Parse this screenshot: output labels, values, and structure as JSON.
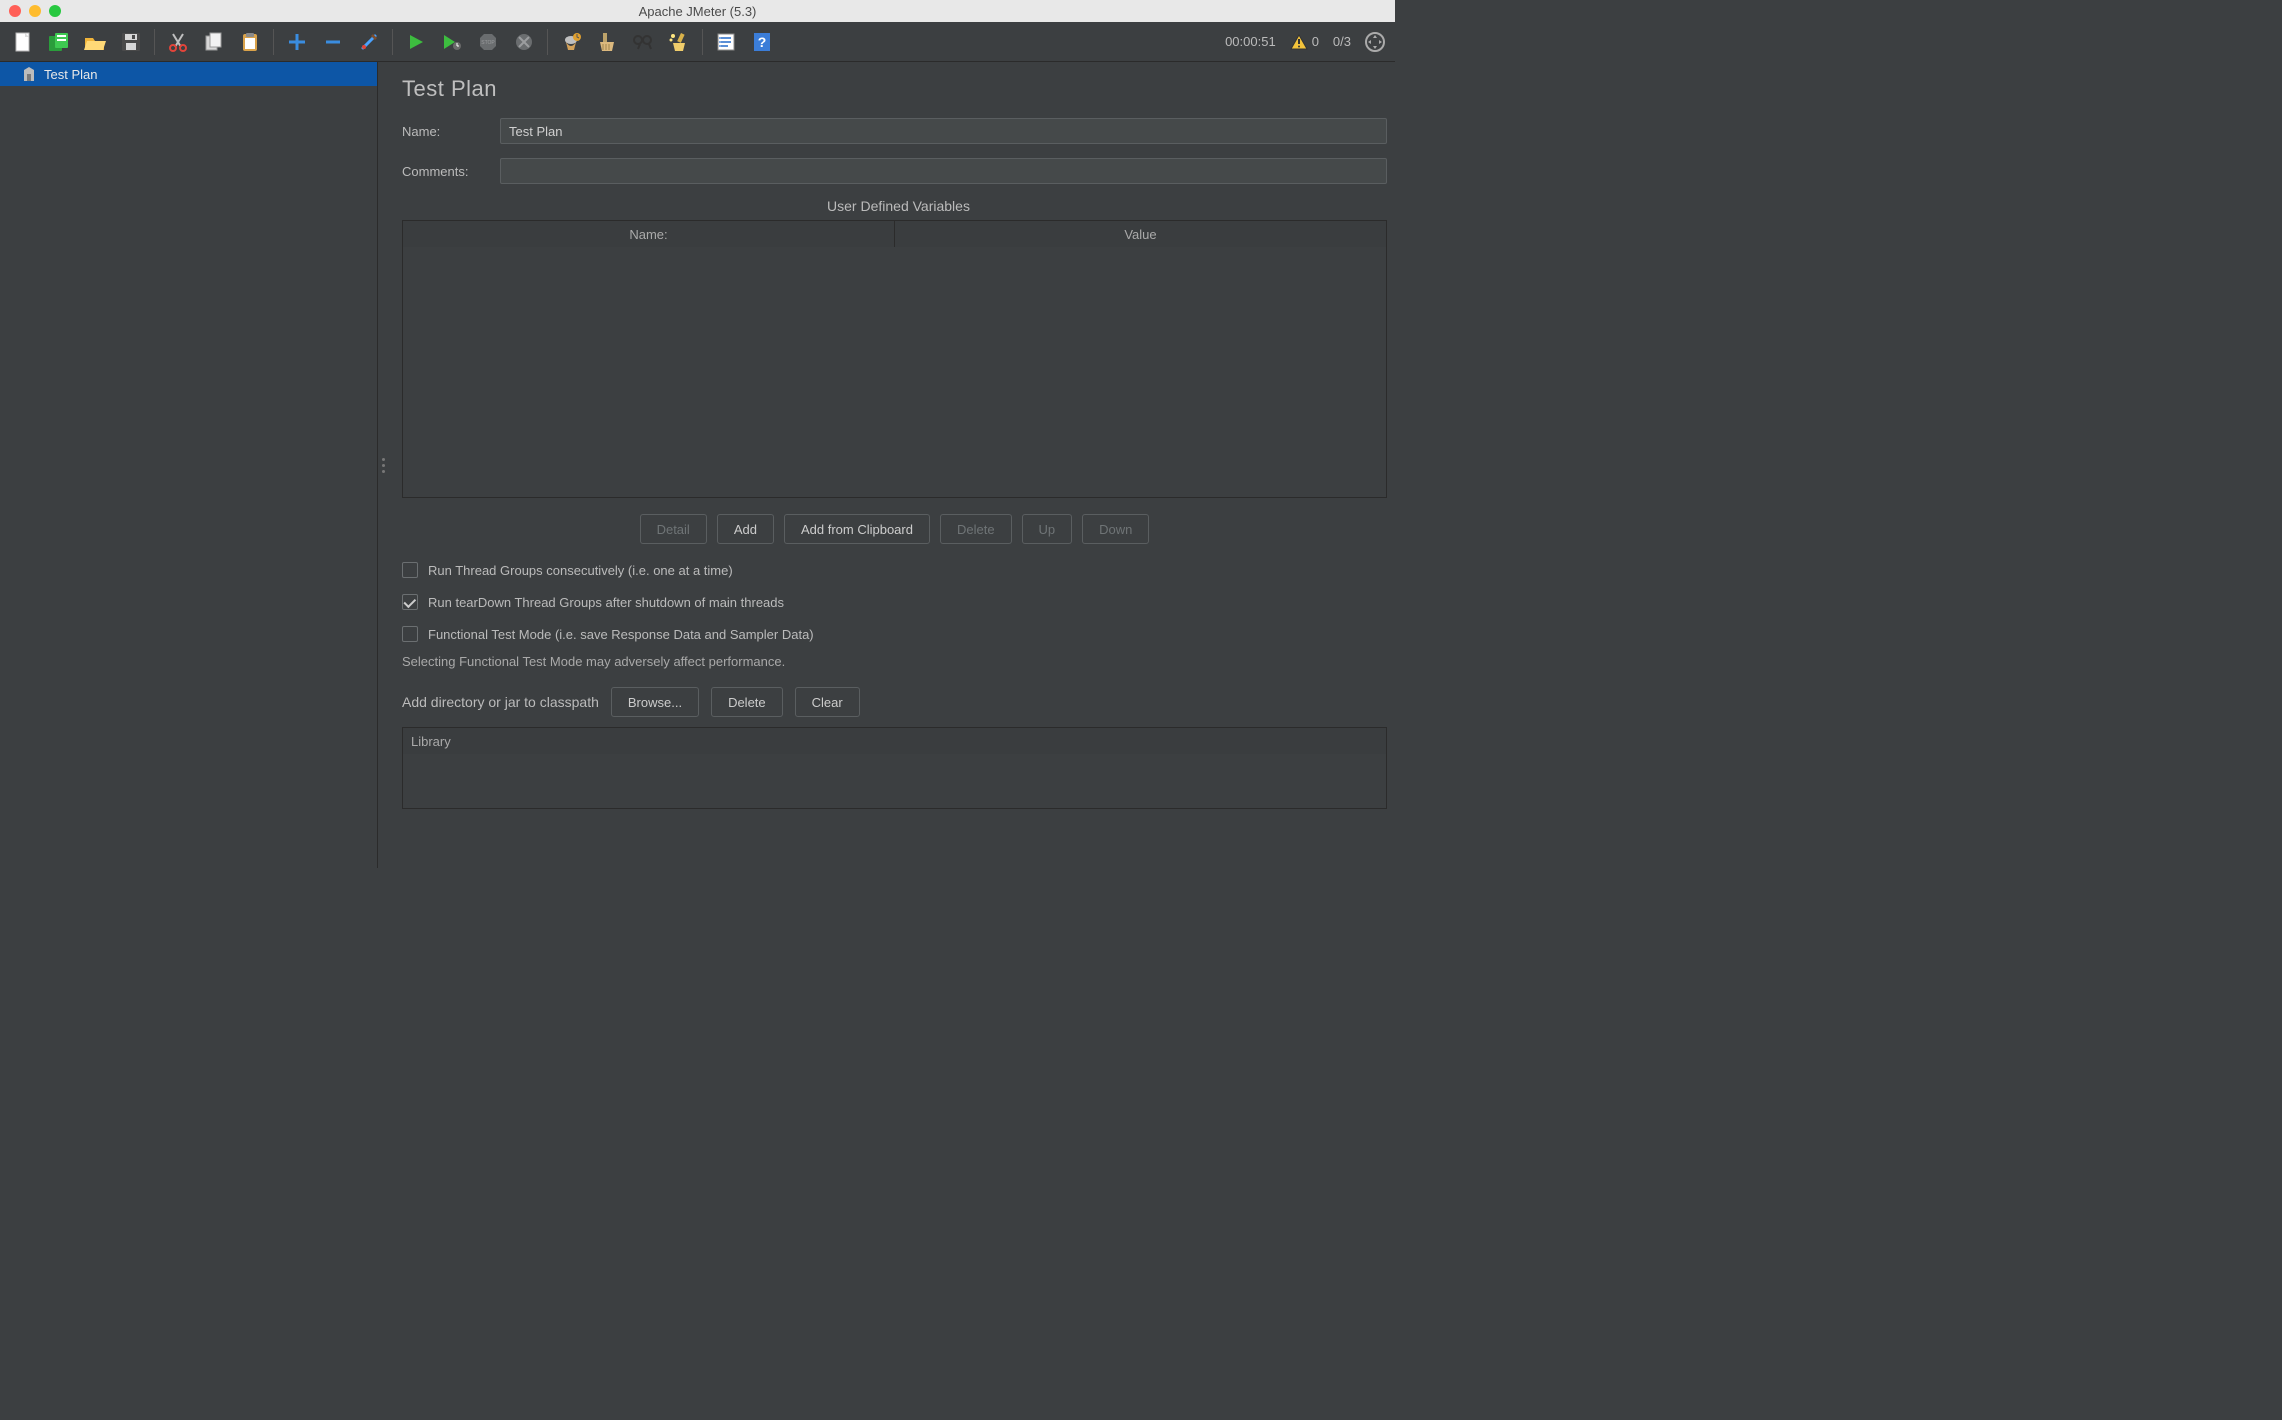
{
  "window": {
    "title": "Apache JMeter (5.3)"
  },
  "status": {
    "elapsed": "00:00:51",
    "warn_count": "0",
    "threads": "0/3"
  },
  "tree": {
    "root_label": "Test Plan"
  },
  "panel": {
    "heading": "Test Plan",
    "name_label": "Name:",
    "name_value": "Test Plan",
    "comments_label": "Comments:",
    "comments_value": "",
    "udv_title": "User Defined Variables",
    "udv_headers": {
      "name": "Name:",
      "value": "Value"
    },
    "buttons": {
      "detail": "Detail",
      "add": "Add",
      "add_clipboard": "Add from Clipboard",
      "delete": "Delete",
      "up": "Up",
      "down": "Down"
    },
    "checks": {
      "consecutive": "Run Thread Groups consecutively (i.e. one at a time)",
      "teardown": "Run tearDown Thread Groups after shutdown of main threads",
      "functional": "Functional Test Mode (i.e. save Response Data and Sampler Data)"
    },
    "functional_note": "Selecting Functional Test Mode may adversely affect performance.",
    "classpath": {
      "label": "Add directory or jar to classpath",
      "browse": "Browse...",
      "delete": "Delete",
      "clear": "Clear",
      "library_header": "Library"
    }
  },
  "icons": {
    "new": "new-file",
    "templates": "templates",
    "open": "open",
    "save": "save",
    "cut": "cut",
    "copy": "copy",
    "paste": "paste",
    "plus": "plus",
    "minus": "minus",
    "toggle": "toggle",
    "start": "start",
    "start_no_timer": "start-no-pauses",
    "stop": "stop",
    "shutdown": "shutdown",
    "gear": "enable-debug",
    "broom1": "clear",
    "find": "search",
    "broom2": "clear-all",
    "props": "function-helper",
    "help": "help",
    "expand": "expand"
  }
}
